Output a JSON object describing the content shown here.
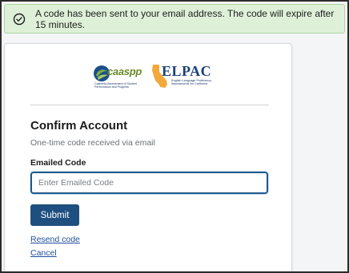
{
  "alert": {
    "icon": "check-circle-icon",
    "message": "A code has been sent to your email address. The code will expire after 15 minutes."
  },
  "logos": {
    "caaspp": {
      "name": "caaspp",
      "tagline": "California Assessment of Student Performance and Progress"
    },
    "elpac": {
      "name": "ELPAC",
      "tagline": "English Language Proficiency Assessments for California"
    }
  },
  "form": {
    "title": "Confirm Account",
    "subtitle": "One-time code received via email",
    "code_label": "Emailed Code",
    "code_placeholder": "Enter Emailed Code",
    "code_value": "",
    "submit_label": "Submit",
    "resend_label": "Resend code",
    "cancel_label": "Cancel"
  },
  "colors": {
    "alert_bg": "#dff0d8",
    "primary_button": "#1f4f7f",
    "input_focus_border": "#1e5a8c",
    "link": "#1f4f9f"
  }
}
